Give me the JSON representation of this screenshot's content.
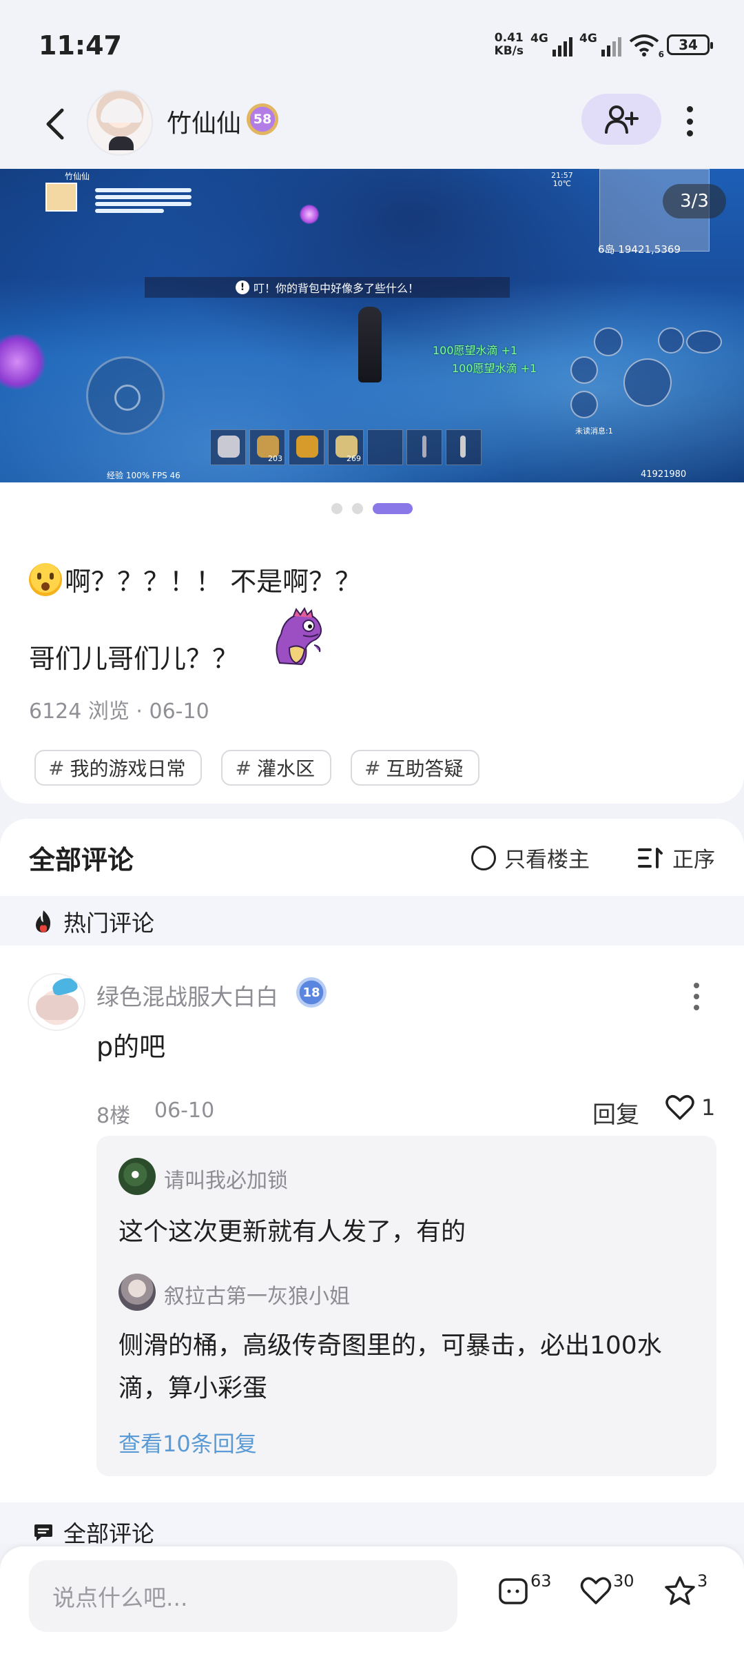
{
  "status_bar": {
    "time": "11:47",
    "net_speed_value": "0.41",
    "net_speed_unit": "KB/s",
    "sim1": "4G",
    "sim2": "4G",
    "wifi_sub": "6",
    "battery": "34"
  },
  "header": {
    "author": "竹仙仙",
    "level": "58"
  },
  "image": {
    "counter": "3/3",
    "current_index": 3,
    "total": 3,
    "game_player_name": "竹仙仙",
    "game_notice": "叮！你的背包中好像多了些什么！",
    "gain_line_1": "100愿望水滴 +1",
    "gain_line_2": "100愿望水滴 +1",
    "map_coords": "6岛 19421,5369",
    "game_clock": "21:57",
    "game_temp": "10℃",
    "slot_counts": [
      "203",
      "269"
    ],
    "footer_status": "经验 100%  FPS 46",
    "player_id": "41921980",
    "chat_hint": "未读消息:1"
  },
  "post": {
    "line1": "啊？？？！！ 不是啊？？",
    "line2": "哥们儿哥们儿？？",
    "views": "6124 浏览",
    "date": "06-10",
    "tags": [
      "我的游戏日常",
      "灌水区",
      "互助答疑"
    ]
  },
  "comments": {
    "title": "全部评论",
    "op_only": "只看楼主",
    "sort": "正序",
    "hot_label": "热门评论",
    "all_label": "全部评论",
    "top": {
      "user": "绿色混战服大白白",
      "level": "18",
      "text": "p的吧",
      "floor": "8楼",
      "date": "06-10",
      "reply_label": "回复",
      "likes": "1",
      "replies": [
        {
          "user": "请叫我必加锁",
          "text": "这个这次更新就有人发了，有的"
        },
        {
          "user": "叙拉古第一灰狼小姐",
          "text": "侧滑的桶，高级传奇图里的，可暴击，必出100水滴，算小彩蛋"
        }
      ],
      "view_more": "查看10条回复"
    }
  },
  "bottom_bar": {
    "placeholder": "说点什么吧...",
    "comment_count": "63",
    "like_count": "30",
    "star_count": "3"
  }
}
